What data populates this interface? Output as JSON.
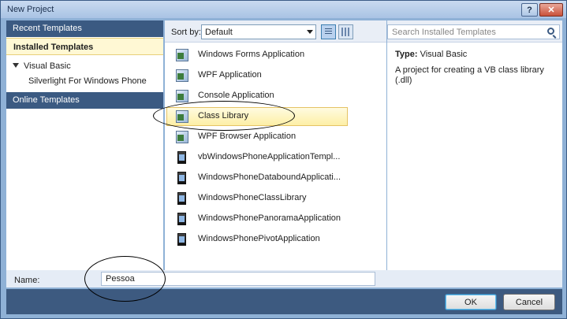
{
  "window": {
    "title": "New Project",
    "help_glyph": "?",
    "close_glyph": "✕"
  },
  "left": {
    "recent_templates": "Recent Templates",
    "installed_templates": "Installed Templates",
    "tree": {
      "visual_basic": "Visual Basic",
      "silverlight_wp": "Silverlight For Windows Phone"
    },
    "online_templates": "Online Templates"
  },
  "toolbar": {
    "sort_by_label": "Sort by:",
    "sort_value": "Default"
  },
  "templates": [
    {
      "label": "Windows Forms Application",
      "icon": "winforms-icon",
      "selected": false
    },
    {
      "label": "WPF Application",
      "icon": "wpf-icon",
      "selected": false
    },
    {
      "label": "Console Application",
      "icon": "console-icon",
      "selected": false
    },
    {
      "label": "Class Library",
      "icon": "class-library-icon",
      "selected": true
    },
    {
      "label": "WPF Browser Application",
      "icon": "wpf-browser-icon",
      "selected": false
    },
    {
      "label": "vbWindowsPhoneApplicationTempl...",
      "icon": "phone-icon",
      "selected": false
    },
    {
      "label": "WindowsPhoneDataboundApplicati...",
      "icon": "phone-icon",
      "selected": false
    },
    {
      "label": "WindowsPhoneClassLibrary",
      "icon": "phone-icon",
      "selected": false
    },
    {
      "label": "WindowsPhonePanoramaApplication",
      "icon": "phone-icon",
      "selected": false
    },
    {
      "label": "WindowsPhonePivotApplication",
      "icon": "phone-icon",
      "selected": false
    }
  ],
  "right": {
    "search_placeholder": "Search Installed Templates",
    "type_key": "Type:",
    "type_value": "Visual Basic",
    "description": "A project for creating a VB class library (.dll)"
  },
  "name_row": {
    "label": "Name:",
    "value": "Pessoa"
  },
  "buttons": {
    "ok": "OK",
    "cancel": "Cancel"
  },
  "colors": {
    "header_blue": "#3b5a82",
    "selection_yellow": "#fdefa6",
    "frame_blue": "#8fb1d6"
  }
}
